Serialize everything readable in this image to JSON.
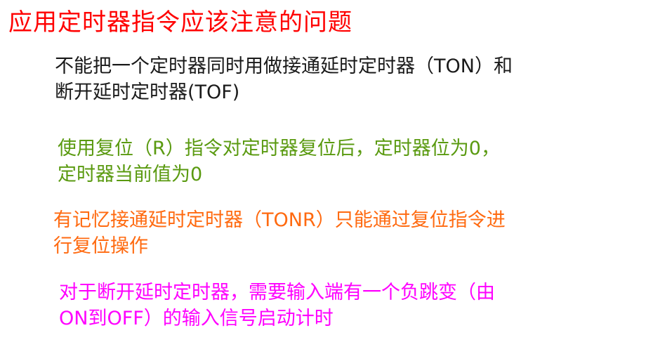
{
  "title": "应用定时器指令应该注意的问题",
  "colors": {
    "title": "#ff0000",
    "note1": "#1a1a1a",
    "note2": "#5a9a10",
    "note3": "#ff6a10",
    "note4": "#ff00ff"
  },
  "notes": [
    {
      "lines": [
        "不能把一个定时器同时用做接通延时定时器（TON）和",
        "断开延时定时器(TOF)"
      ]
    },
    {
      "lines": [
        "使用复位（R）指令对定时器复位后，定时器位为0，",
        "定时器当前值为0"
      ]
    },
    {
      "lines": [
        "有记忆接通延时定时器（TONR）只能通过复位指令进",
        "行复位操作"
      ]
    },
    {
      "lines": [
        "对于断开延时定时器，需要输入端有一个负跳变（由",
        "ON到OFF）的输入信号启动计时"
      ]
    }
  ]
}
